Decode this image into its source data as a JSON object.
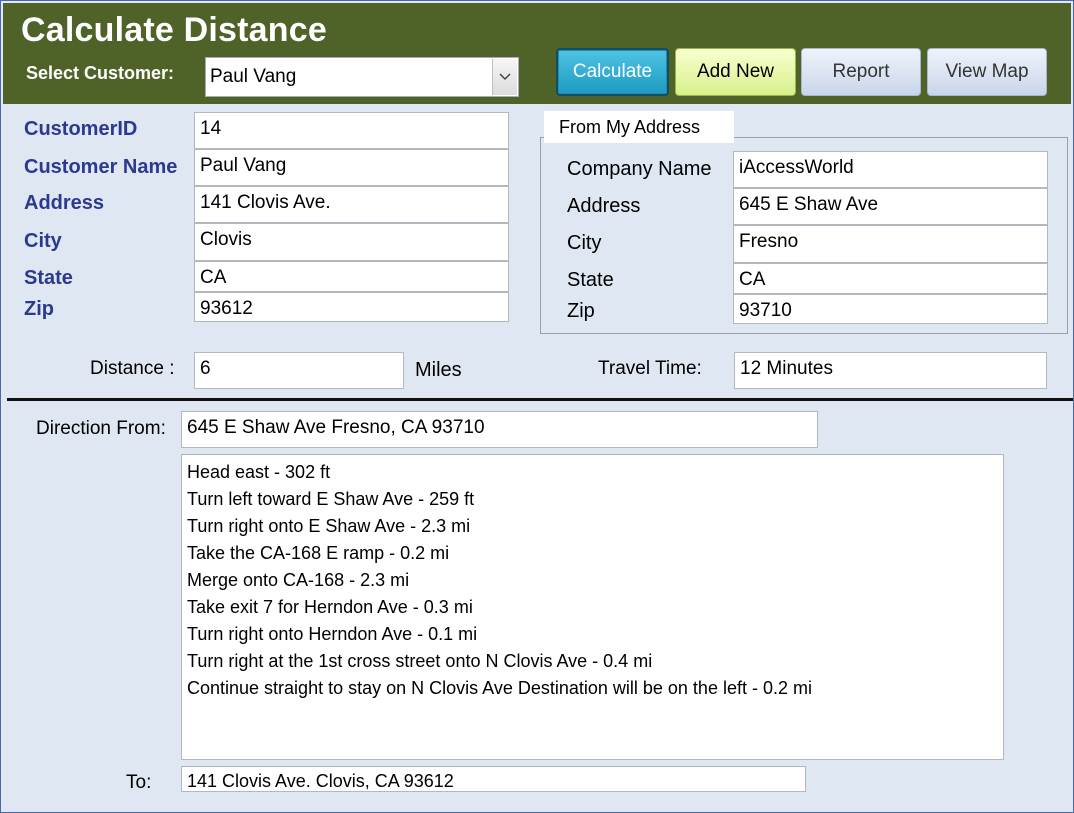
{
  "header": {
    "title": "Calculate Distance",
    "select_customer_label": "Select Customer:",
    "customer_value": "Paul Vang",
    "buttons": {
      "calculate": "Calculate",
      "add_new": "Add New",
      "report": "Report",
      "view_map": "View Map"
    }
  },
  "customer": {
    "labels": {
      "customer_id": "CustomerID",
      "customer_name": "Customer Name",
      "address": "Address",
      "city": "City",
      "state": "State",
      "zip": "Zip"
    },
    "values": {
      "customer_id": "14",
      "customer_name": "Paul Vang",
      "address": "141 Clovis Ave.",
      "city": "Clovis",
      "state": "CA",
      "zip": "93612"
    }
  },
  "from_address": {
    "group_title": "From My Address",
    "labels": {
      "company_name": "Company Name",
      "address": "Address",
      "city": "City",
      "state": "State",
      "zip": "Zip"
    },
    "values": {
      "company_name": "iAccessWorld",
      "address": "645 E Shaw Ave",
      "city": "Fresno",
      "state": "CA",
      "zip": "93710"
    }
  },
  "result": {
    "distance_label": "Distance :",
    "distance_value": "6",
    "distance_unit": "Miles",
    "travel_time_label": "Travel Time:",
    "travel_time_value": "12 Minutes"
  },
  "directions": {
    "from_label": "Direction From:",
    "from_value": "645 E Shaw Ave  Fresno,  CA 93710",
    "steps": [
      "Head  east  - 302 ft",
      "Turn  left  toward  E Shaw Ave  - 259 ft",
      "Turn  right  onto  E Shaw Ave  - 2.3 mi",
      "Take the  CA-168 E  ramp - 0.2 mi",
      "Merge onto  CA-168  - 2.3 mi",
      "Take exit  7  for  Herndon Ave  - 0.3 mi",
      "Turn  right  onto  Herndon Ave  - 0.1 mi",
      "Turn  right  at the 1st cross street onto  N Clovis Ave  - 0.4 mi",
      "Continue straight to stay on  N Clovis Ave  Destination will be on the left  - 0.2 mi"
    ],
    "to_label": "To:",
    "to_value": "141 Clovis Ave.  Clovis,  CA 93612"
  }
}
